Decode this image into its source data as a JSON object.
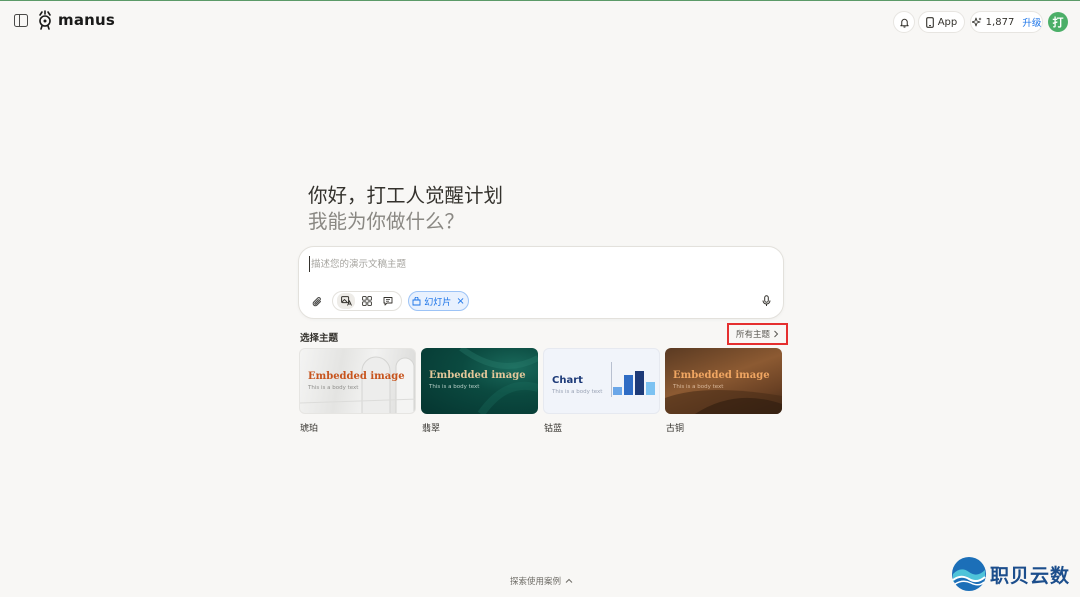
{
  "header": {
    "brand": "manus",
    "app_label": "App",
    "credits": "1,877",
    "upgrade_label": "升级",
    "avatar_initial": "打"
  },
  "greeting": {
    "line1": "你好，打工人觉醒计划",
    "line2": "我能为你做什么？"
  },
  "input": {
    "placeholder": "描述您的演示文稿主题",
    "value": "",
    "chip_label": "幻灯片"
  },
  "themes": {
    "section_label": "选择主题",
    "all_label": "所有主题",
    "items": [
      {
        "name": "琥珀",
        "title": "Embedded image",
        "body": "This is a body text"
      },
      {
        "name": "翡翠",
        "title": "Embedded image",
        "body": "This is a body text"
      },
      {
        "name": "钴蓝",
        "title": "Chart",
        "body": "This is a body text"
      },
      {
        "name": "古铜",
        "title": "Embedded image",
        "body": "This is a body text"
      }
    ]
  },
  "footer": {
    "explore_label": "探索使用案例"
  },
  "watermark": {
    "text": "职贝云数"
  },
  "colors": {
    "accent_blue": "#1a73e8",
    "avatar_green": "#4caf68",
    "highlight_red": "#e52f2f"
  },
  "icons": [
    "sidebar-toggle-icon",
    "manus-logo-icon",
    "bell-icon",
    "phone-icon",
    "sparkle-icon",
    "paperclip-icon",
    "image-text-icon",
    "grid-icon",
    "chat-icon",
    "slides-icon",
    "close-icon",
    "microphone-icon",
    "chevron-right-icon",
    "chevron-up-icon"
  ]
}
